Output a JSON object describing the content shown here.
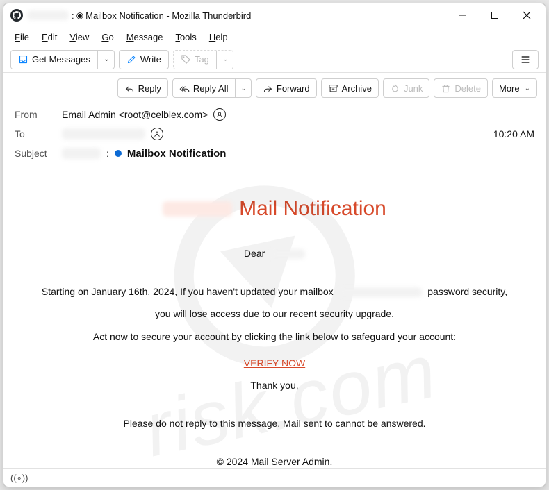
{
  "window": {
    "title_suffix": "Mailbox Notification - Mozilla Thunderbird",
    "title_separator": ":"
  },
  "menubar": [
    "File",
    "Edit",
    "View",
    "Go",
    "Message",
    "Tools",
    "Help"
  ],
  "toolbar": {
    "get_messages": "Get Messages",
    "write": "Write",
    "tag": "Tag"
  },
  "actions": {
    "reply": "Reply",
    "reply_all": "Reply All",
    "forward": "Forward",
    "archive": "Archive",
    "junk": "Junk",
    "delete": "Delete",
    "more": "More"
  },
  "headers": {
    "from_label": "From",
    "to_label": "To",
    "subject_label": "Subject",
    "from_value": "Email Admin <root@celblex.com>",
    "time": "10:20 AM",
    "subject_text": "Mailbox Notification",
    "subject_separator": ":"
  },
  "body": {
    "heading": "Mail Notification",
    "dear": "Dear",
    "p1_a": "Starting on January 16th, 2024, If you haven't updated your mailbox",
    "p1_b": "password security,",
    "p2": "you will lose access due to our recent security upgrade.",
    "p3": "Act now to secure your account by clicking the link below to safeguard your account:",
    "verify": "VERIFY NOW",
    "thank": "Thank you,",
    "no_reply": "Please do not reply to this message. Mail sent to cannot be answered.",
    "copyright": "© 2024 Mail Server Admin."
  },
  "watermark": {
    "text": "risk.com"
  }
}
